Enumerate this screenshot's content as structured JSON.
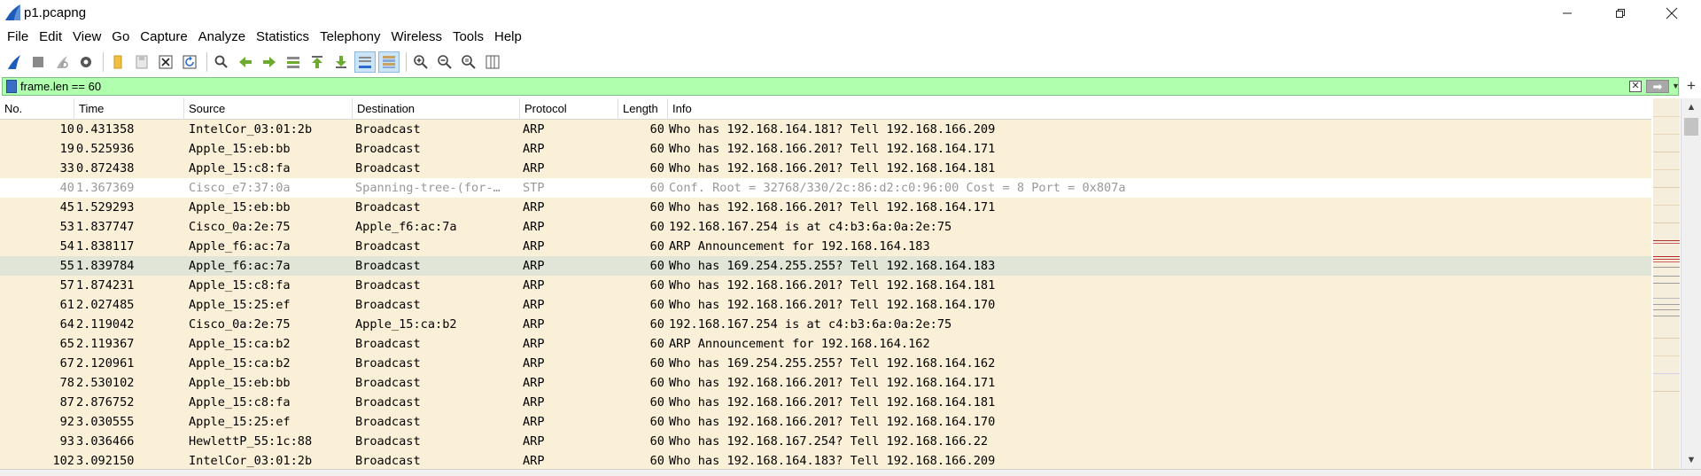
{
  "window": {
    "title": "p1.pcapng"
  },
  "menu": [
    "File",
    "Edit",
    "View",
    "Go",
    "Capture",
    "Analyze",
    "Statistics",
    "Telephony",
    "Wireless",
    "Tools",
    "Help"
  ],
  "toolbar": {
    "icons": [
      "shark-fin-start-icon",
      "stop-icon",
      "restart-icon",
      "capture-options-icon",
      "open-file-icon",
      "save-file-icon",
      "close-file-icon",
      "reload-icon",
      "find-icon",
      "go-back-icon",
      "go-forward-icon",
      "go-to-packet-icon",
      "first-packet-icon",
      "last-packet-icon",
      "autoscroll-icon",
      "colorize-icon",
      "zoom-in-icon",
      "zoom-out-icon",
      "zoom-normal-icon",
      "resize-columns-icon"
    ]
  },
  "filter": {
    "value": "frame.len == 60"
  },
  "columns": [
    "No.",
    "Time",
    "Source",
    "Destination",
    "Protocol",
    "Length",
    "Info"
  ],
  "colors": {
    "arp_row": "#faf0d7",
    "selected_row": "#e1e5d7",
    "stp_row": "#ffffff",
    "stp_text": "#999999",
    "filter_bg": "#afffaf"
  },
  "packets": [
    {
      "no": "10",
      "time": "0.431358",
      "src": "IntelCor_03:01:2b",
      "dst": "Broadcast",
      "proto": "ARP",
      "len": "60",
      "info": "Who has 192.168.164.181? Tell 192.168.166.209",
      "style": "arp"
    },
    {
      "no": "19",
      "time": "0.525936",
      "src": "Apple_15:eb:bb",
      "dst": "Broadcast",
      "proto": "ARP",
      "len": "60",
      "info": "Who has 192.168.166.201? Tell 192.168.164.171",
      "style": "arp"
    },
    {
      "no": "33",
      "time": "0.872438",
      "src": "Apple_15:c8:fa",
      "dst": "Broadcast",
      "proto": "ARP",
      "len": "60",
      "info": "Who has 192.168.166.201? Tell 192.168.164.181",
      "style": "arp"
    },
    {
      "no": "40",
      "time": "1.367369",
      "src": "Cisco_e7:37:0a",
      "dst": "Spanning-tree-(for-…",
      "proto": "STP",
      "len": "60",
      "info": "Conf. Root = 32768/330/2c:86:d2:c0:96:00  Cost = 8  Port = 0x807a",
      "style": "stp"
    },
    {
      "no": "45",
      "time": "1.529293",
      "src": "Apple_15:eb:bb",
      "dst": "Broadcast",
      "proto": "ARP",
      "len": "60",
      "info": "Who has 192.168.166.201? Tell 192.168.164.171",
      "style": "arp"
    },
    {
      "no": "53",
      "time": "1.837747",
      "src": "Cisco_0a:2e:75",
      "dst": "Apple_f6:ac:7a",
      "proto": "ARP",
      "len": "60",
      "info": "192.168.167.254 is at c4:b3:6a:0a:2e:75",
      "style": "arp"
    },
    {
      "no": "54",
      "time": "1.838117",
      "src": "Apple_f6:ac:7a",
      "dst": "Broadcast",
      "proto": "ARP",
      "len": "60",
      "info": "ARP Announcement for 192.168.164.183",
      "style": "arp"
    },
    {
      "no": "55",
      "time": "1.839784",
      "src": "Apple_f6:ac:7a",
      "dst": "Broadcast",
      "proto": "ARP",
      "len": "60",
      "info": "Who has 169.254.255.255? Tell 192.168.164.183",
      "style": "selected"
    },
    {
      "no": "57",
      "time": "1.874231",
      "src": "Apple_15:c8:fa",
      "dst": "Broadcast",
      "proto": "ARP",
      "len": "60",
      "info": "Who has 192.168.166.201? Tell 192.168.164.181",
      "style": "arp"
    },
    {
      "no": "61",
      "time": "2.027485",
      "src": "Apple_15:25:ef",
      "dst": "Broadcast",
      "proto": "ARP",
      "len": "60",
      "info": "Who has 192.168.166.201? Tell 192.168.164.170",
      "style": "arp"
    },
    {
      "no": "64",
      "time": "2.119042",
      "src": "Cisco_0a:2e:75",
      "dst": "Apple_15:ca:b2",
      "proto": "ARP",
      "len": "60",
      "info": "192.168.167.254 is at c4:b3:6a:0a:2e:75",
      "style": "arp"
    },
    {
      "no": "65",
      "time": "2.119367",
      "src": "Apple_15:ca:b2",
      "dst": "Broadcast",
      "proto": "ARP",
      "len": "60",
      "info": "ARP Announcement for 192.168.164.162",
      "style": "arp"
    },
    {
      "no": "67",
      "time": "2.120961",
      "src": "Apple_15:ca:b2",
      "dst": "Broadcast",
      "proto": "ARP",
      "len": "60",
      "info": "Who has 169.254.255.255? Tell 192.168.164.162",
      "style": "arp"
    },
    {
      "no": "78",
      "time": "2.530102",
      "src": "Apple_15:eb:bb",
      "dst": "Broadcast",
      "proto": "ARP",
      "len": "60",
      "info": "Who has 192.168.166.201? Tell 192.168.164.171",
      "style": "arp"
    },
    {
      "no": "87",
      "time": "2.876752",
      "src": "Apple_15:c8:fa",
      "dst": "Broadcast",
      "proto": "ARP",
      "len": "60",
      "info": "Who has 192.168.166.201? Tell 192.168.164.181",
      "style": "arp"
    },
    {
      "no": "92",
      "time": "3.030555",
      "src": "Apple_15:25:ef",
      "dst": "Broadcast",
      "proto": "ARP",
      "len": "60",
      "info": "Who has 192.168.166.201? Tell 192.168.164.170",
      "style": "arp"
    },
    {
      "no": "93",
      "time": "3.036466",
      "src": "HewlettP_55:1c:88",
      "dst": "Broadcast",
      "proto": "ARP",
      "len": "60",
      "info": "Who has 192.168.167.254? Tell 192.168.166.22",
      "style": "arp"
    },
    {
      "no": "102",
      "time": "3.092150",
      "src": "IntelCor_03:01:2b",
      "dst": "Broadcast",
      "proto": "ARP",
      "len": "60",
      "info": "Who has 192.168.164.183? Tell 192.168.166.209",
      "style": "arp"
    }
  ]
}
